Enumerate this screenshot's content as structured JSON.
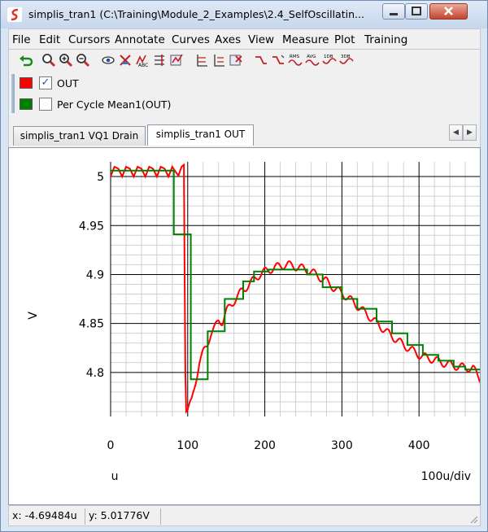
{
  "window": {
    "title": "simplis_tran1 (C:\\Training\\Module_2_Examples\\2.4_SelfOscillatin...",
    "app_icon": "simplis-logo-icon"
  },
  "menu": [
    "File",
    "Edit",
    "Cursors",
    "Annotate",
    "Curves",
    "Axes",
    "View",
    "Measure",
    "Plot",
    "Training"
  ],
  "toolbar": {
    "icons": [
      "undo-icon",
      "zoom-box-icon",
      "zoom-in-icon",
      "zoom-out-icon",
      "show-curve-icon",
      "hide-curve-icon",
      "curve-abc-icon",
      "add-grid-icon",
      "edit-curves-icon",
      "stack-axes-icon",
      "separate-axes-icon",
      "delete-axes-icon",
      "cursor-step-icon",
      "cursor-step-down-icon",
      "rms-icon",
      "avg-icon",
      "db-icon",
      "3db-icon"
    ],
    "rms_label": "RMS",
    "avg_label": "AVG",
    "db_label": "1DB",
    "db3_label": "3DB"
  },
  "legend": [
    {
      "label": "OUT",
      "color": "#ff0000",
      "checked": true
    },
    {
      "label": "Per Cycle Mean1(OUT)",
      "color": "#008000",
      "checked": false
    }
  ],
  "tabs": [
    {
      "label": "simplis_tran1 VQ1 Drain",
      "active": false
    },
    {
      "label": "simplis_tran1 OUT",
      "active": true
    }
  ],
  "chart_data": {
    "type": "line",
    "xlabel": "u",
    "x_div_label": "100u/div",
    "ylabel": "V",
    "xlim": [
      0,
      480
    ],
    "ylim": [
      4.755,
      5.015
    ],
    "x_ticks": [
      "0",
      "100",
      "200",
      "300",
      "400"
    ],
    "y_ticks": [
      "5",
      "4.95",
      "4.9",
      "4.85",
      "4.8"
    ],
    "grid": true,
    "series": [
      {
        "name": "OUT",
        "color": "#ff0000",
        "points": [
          [
            0,
            5.0
          ],
          [
            5,
            5.01
          ],
          [
            10,
            5.008
          ],
          [
            15,
            5.0
          ],
          [
            20,
            5.01
          ],
          [
            25,
            5.008
          ],
          [
            30,
            5.0
          ],
          [
            35,
            5.01
          ],
          [
            40,
            5.008
          ],
          [
            45,
            5.0
          ],
          [
            50,
            5.01
          ],
          [
            55,
            5.008
          ],
          [
            60,
            5.0
          ],
          [
            65,
            5.01
          ],
          [
            70,
            5.008
          ],
          [
            75,
            5.0
          ],
          [
            80,
            5.01
          ],
          [
            85,
            5.004
          ],
          [
            88,
            5.001
          ],
          [
            92,
            5.01
          ],
          [
            95,
            5.012
          ],
          [
            96,
            4.9
          ],
          [
            97,
            4.8
          ],
          [
            98,
            4.76
          ],
          [
            100,
            4.762
          ],
          [
            105,
            4.77
          ],
          [
            110,
            4.79
          ],
          [
            115,
            4.81
          ],
          [
            120,
            4.82
          ],
          [
            125,
            4.828
          ],
          [
            130,
            4.84
          ],
          [
            135,
            4.845
          ],
          [
            140,
            4.853
          ],
          [
            145,
            4.852
          ],
          [
            150,
            4.862
          ],
          [
            160,
            4.873
          ],
          [
            170,
            4.883
          ],
          [
            180,
            4.89
          ],
          [
            190,
            4.898
          ],
          [
            200,
            4.903
          ],
          [
            210,
            4.906
          ],
          [
            220,
            4.909
          ],
          [
            230,
            4.91
          ],
          [
            240,
            4.908
          ],
          [
            250,
            4.906
          ],
          [
            260,
            4.903
          ],
          [
            270,
            4.898
          ],
          [
            280,
            4.893
          ],
          [
            290,
            4.886
          ],
          [
            300,
            4.881
          ],
          [
            310,
            4.875
          ],
          [
            320,
            4.868
          ],
          [
            330,
            4.861
          ],
          [
            340,
            4.854
          ],
          [
            350,
            4.847
          ],
          [
            360,
            4.84
          ],
          [
            370,
            4.834
          ],
          [
            380,
            4.828
          ],
          [
            390,
            4.823
          ],
          [
            400,
            4.818
          ],
          [
            410,
            4.815
          ],
          [
            420,
            4.813
          ],
          [
            430,
            4.81
          ],
          [
            440,
            4.808
          ],
          [
            450,
            4.806
          ],
          [
            460,
            4.805
          ],
          [
            470,
            4.804
          ],
          [
            480,
            4.793
          ]
        ],
        "ripple": {
          "amplitude": 0.004,
          "period": 16,
          "start": 100
        }
      },
      {
        "name": "Per Cycle Mean1(OUT)",
        "color": "#008000",
        "steps": [
          [
            0,
            5.006
          ],
          [
            82,
            5.006
          ],
          [
            82,
            4.941
          ],
          [
            104,
            4.941
          ],
          [
            104,
            4.793
          ],
          [
            126,
            4.793
          ],
          [
            126,
            4.842
          ],
          [
            148,
            4.842
          ],
          [
            148,
            4.875
          ],
          [
            172,
            4.875
          ],
          [
            172,
            4.893
          ],
          [
            186,
            4.893
          ],
          [
            186,
            4.903
          ],
          [
            205,
            4.903
          ],
          [
            205,
            4.905
          ],
          [
            255,
            4.905
          ],
          [
            255,
            4.9
          ],
          [
            275,
            4.9
          ],
          [
            275,
            4.887
          ],
          [
            300,
            4.887
          ],
          [
            300,
            4.875
          ],
          [
            320,
            4.875
          ],
          [
            320,
            4.865
          ],
          [
            345,
            4.865
          ],
          [
            345,
            4.852
          ],
          [
            365,
            4.852
          ],
          [
            365,
            4.84
          ],
          [
            385,
            4.84
          ],
          [
            385,
            4.828
          ],
          [
            405,
            4.828
          ],
          [
            405,
            4.818
          ],
          [
            425,
            4.818
          ],
          [
            425,
            4.812
          ],
          [
            445,
            4.812
          ],
          [
            445,
            4.806
          ],
          [
            460,
            4.806
          ],
          [
            460,
            4.803
          ],
          [
            480,
            4.803
          ]
        ]
      }
    ]
  },
  "status": {
    "x_readout": "x: -4.69484u",
    "y_readout": "y: 5.01776V"
  }
}
